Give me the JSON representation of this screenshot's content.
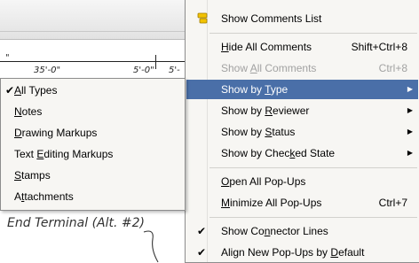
{
  "background": {
    "dimension_left": "35'-0\"",
    "dimension_right_1": "5'-0\"",
    "dimension_right_2": "5'-",
    "tick_label": "\"",
    "drawing_label": "End Terminal (Alt. #2)"
  },
  "main_menu": {
    "items": [
      {
        "label_pre": "",
        "label_u": "",
        "label_post": "Show Comments List",
        "shortcut": "",
        "icon": "comments-list-icon"
      },
      {
        "label_pre": "",
        "label_u": "H",
        "label_post": "ide All Comments",
        "shortcut": "Shift+Ctrl+8"
      },
      {
        "label_pre": "Show ",
        "label_u": "A",
        "label_post": "ll Comments",
        "shortcut": "Ctrl+8",
        "disabled": true
      },
      {
        "label_pre": "Show by ",
        "label_u": "T",
        "label_post": "ype",
        "submenu": true,
        "highlighted": true
      },
      {
        "label_pre": "Show by ",
        "label_u": "R",
        "label_post": "eviewer",
        "submenu": true
      },
      {
        "label_pre": "Show by ",
        "label_u": "S",
        "label_post": "tatus",
        "submenu": true
      },
      {
        "label_pre": "Show by Chec",
        "label_u": "k",
        "label_post": "ed State",
        "submenu": true
      },
      {
        "label_pre": "",
        "label_u": "O",
        "label_post": "pen All Pop-Ups",
        "shortcut": ""
      },
      {
        "label_pre": "",
        "label_u": "M",
        "label_post": "inimize All Pop-Ups",
        "shortcut": "Ctrl+7"
      },
      {
        "label_pre": "Show Co",
        "label_u": "n",
        "label_post": "nector Lines",
        "checked": true
      },
      {
        "label_pre": "Align New Pop-Ups by ",
        "label_u": "D",
        "label_post": "efault",
        "checked": true
      }
    ],
    "check_glyph": "✔",
    "submenu_arrow": "▶"
  },
  "sub_menu": {
    "items": [
      {
        "label_pre": "",
        "label_u": "A",
        "label_post": "ll Types",
        "checked": true
      },
      {
        "label_pre": "",
        "label_u": "N",
        "label_post": "otes"
      },
      {
        "label_pre": "",
        "label_u": "D",
        "label_post": "rawing Markups"
      },
      {
        "label_pre": "Text ",
        "label_u": "E",
        "label_post": "diting Markups"
      },
      {
        "label_pre": "",
        "label_u": "S",
        "label_post": "tamps"
      },
      {
        "label_pre": "A",
        "label_u": "t",
        "label_post": "tachments"
      }
    ]
  },
  "colors": {
    "highlight": "#4a6fa8",
    "menu_bg": "#f7f6f3",
    "disabled": "#a2a2a2"
  }
}
